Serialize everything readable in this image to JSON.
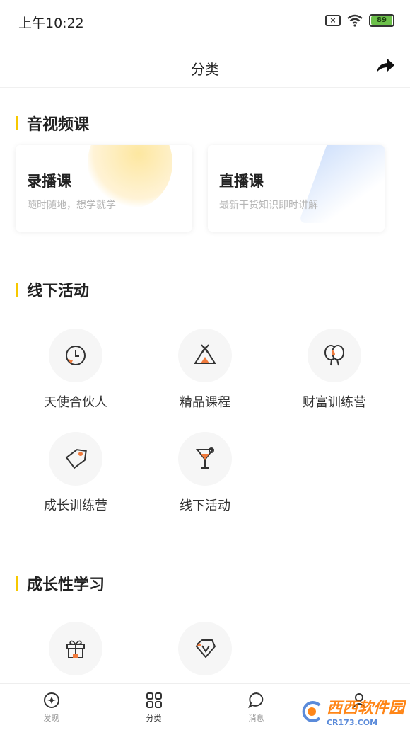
{
  "status_bar": {
    "time": "上午10:22",
    "battery": "89"
  },
  "header": {
    "title": "分类"
  },
  "sections": [
    {
      "title": "音视频课"
    },
    {
      "title": "线下活动"
    },
    {
      "title": "成长性学习"
    }
  ],
  "cards": [
    {
      "title": "录播课",
      "subtitle": "随时随地，想学就学"
    },
    {
      "title": "直播课",
      "subtitle": "最新干货知识即时讲解"
    }
  ],
  "offline_items": [
    {
      "label": "天使合伙人",
      "icon": "clock-icon"
    },
    {
      "label": "精品课程",
      "icon": "tent-icon"
    },
    {
      "label": "财富训练营",
      "icon": "balloons-icon"
    },
    {
      "label": "成长训练营",
      "icon": "tag-icon"
    },
    {
      "label": "线下活动",
      "icon": "cocktail-icon"
    }
  ],
  "growth_items": [
    {
      "icon": "gift-icon"
    },
    {
      "icon": "vip-diamond-icon"
    }
  ],
  "tabs": [
    {
      "label": "发现",
      "icon": "compass-icon"
    },
    {
      "label": "分类",
      "icon": "grid-icon"
    },
    {
      "label": "消息",
      "icon": "chat-icon"
    },
    {
      "label": "",
      "icon": "user-icon"
    }
  ],
  "watermark": {
    "text": "西西软件园",
    "sub": "CR173.COM"
  },
  "colors": {
    "accent": "#f7c800",
    "icon_accent": "#f07a3c"
  }
}
